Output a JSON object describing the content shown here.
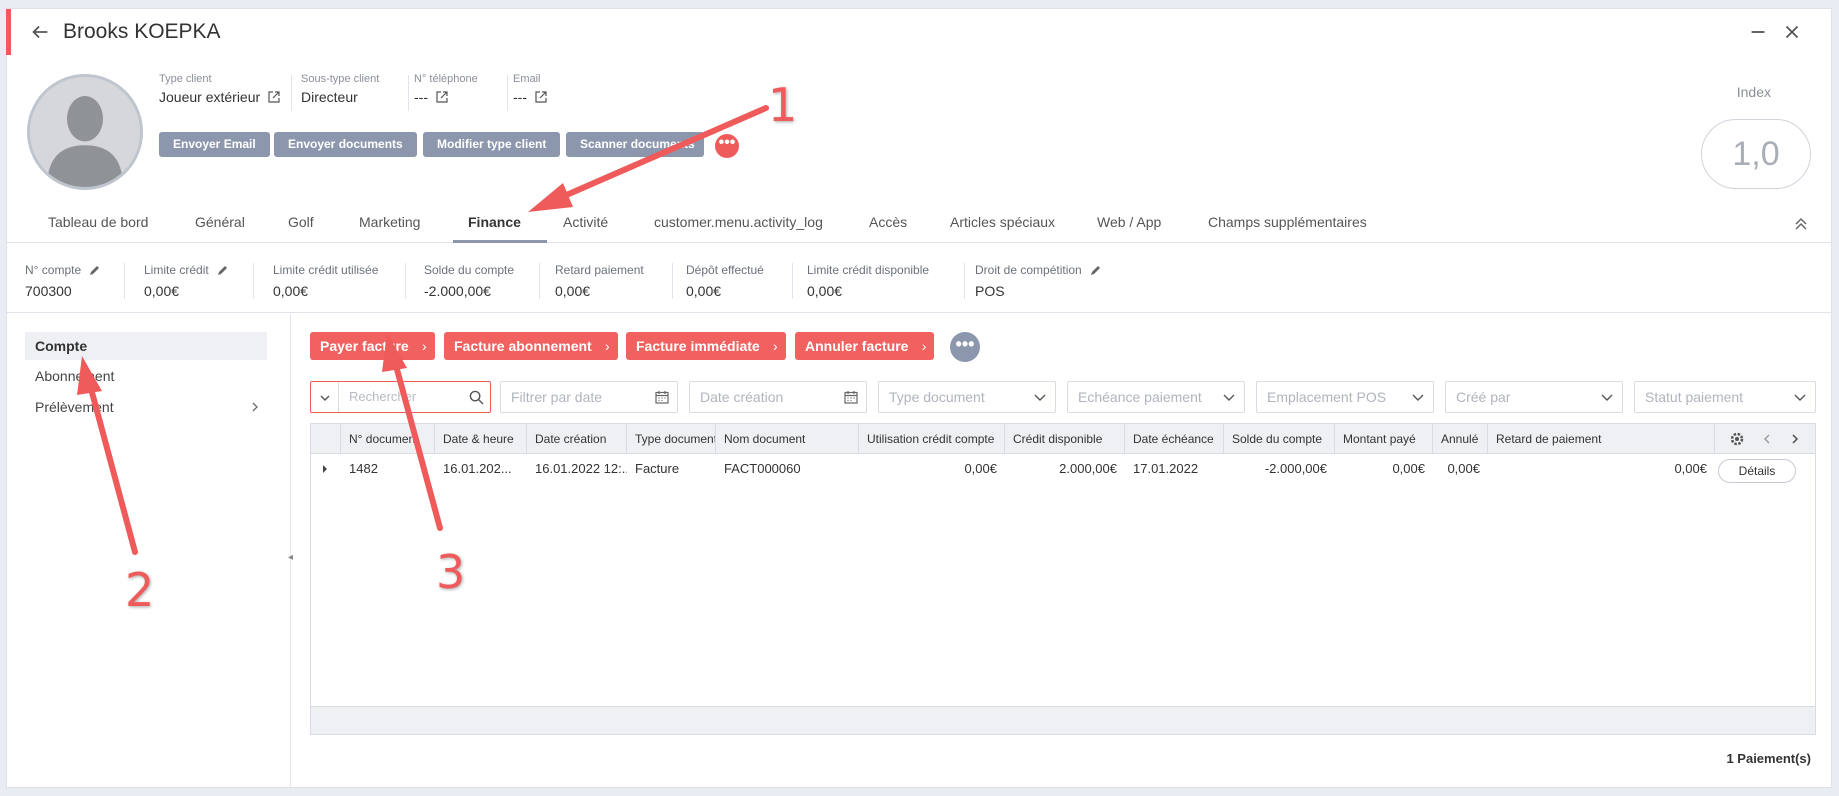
{
  "window": {
    "title": "Brooks KOEPKA",
    "back_icon": "arrow-left-icon",
    "minimize_icon": "minus-icon",
    "close_icon": "close-icon"
  },
  "profile": {
    "avatar_icon": "user-silhouette-icon",
    "type_client_label": "Type client",
    "type_client_value": "Joueur extérieur",
    "sous_type_label": "Sous-type client",
    "sous_type_value": "Directeur",
    "telephone_label": "N° téléphone",
    "telephone_value": "---",
    "email_label": "Email",
    "email_value": "---"
  },
  "actions": {
    "envoyer_email": "Envoyer Email",
    "envoyer_documents": "Envoyer documents",
    "modifier_type": "Modifier type client",
    "scanner": "Scanner documents",
    "more": "•••"
  },
  "index": {
    "label": "Index",
    "value": "1,0"
  },
  "tabs": [
    {
      "label": "Tableau de bord"
    },
    {
      "label": "Général"
    },
    {
      "label": "Golf"
    },
    {
      "label": "Marketing"
    },
    {
      "label": "Finance"
    },
    {
      "label": "Activité"
    },
    {
      "label": "customer.menu.activity_log"
    },
    {
      "label": "Accès"
    },
    {
      "label": "Articles spéciaux"
    },
    {
      "label": "Web / App"
    },
    {
      "label": "Champs supplémentaires"
    }
  ],
  "active_tab": "Finance",
  "finance": [
    {
      "label": "N° compte",
      "value": "700300"
    },
    {
      "label": "Limite crédit",
      "value": "0,00€"
    },
    {
      "label": "Limite crédit utilisée",
      "value": "0,00€"
    },
    {
      "label": "Solde du compte",
      "value": "-2.000,00€"
    },
    {
      "label": "Retard paiement",
      "value": "0,00€"
    },
    {
      "label": "Dépôt effectué",
      "value": "0,00€"
    },
    {
      "label": "Limite crédit disponible",
      "value": "0,00€"
    },
    {
      "label": "Droit de compétition",
      "value": "POS"
    }
  ],
  "sidebar": {
    "items": [
      {
        "label": "Compte"
      },
      {
        "label": "Abonnement"
      },
      {
        "label": "Prélèvement"
      }
    ]
  },
  "invoice_buttons": {
    "payer": "Payer facture",
    "abonnement": "Facture abonnement",
    "immediate": "Facture immédiate",
    "annuler": "Annuler facture",
    "chevron": "›",
    "more": "•••"
  },
  "filters": {
    "search_placeholder": "Rechercher",
    "date": "Filtrer par date",
    "date_creation": "Date création",
    "type_document": "Type document",
    "echeance": "Echéance paiement",
    "emplacement": "Emplacement POS",
    "cree_par": "Créé par",
    "statut": "Statut paiement"
  },
  "table": {
    "headers": [
      "N° document",
      "Date & heure",
      "Date création",
      "Type document",
      "Nom document",
      "Utilisation crédit compte",
      "Crédit disponible",
      "Date échéance",
      "Solde du compte",
      "Montant payé",
      "Annulé",
      "Retard de paiement"
    ],
    "rows": [
      {
        "numero": "1482",
        "date_heure": "16.01.202...",
        "date_creation": "16.01.2022 12:...",
        "type": "Facture",
        "nom": "FACT000060",
        "utilisation": "0,00€",
        "credit": "2.000,00€",
        "echeance": "17.01.2022",
        "solde": "-2.000,00€",
        "montant": "0,00€",
        "annule": "0,00€",
        "retard": "0,00€",
        "details": "Détails"
      }
    ]
  },
  "footer": {
    "count": "1 Paiement(s)"
  },
  "annotations": {
    "n1": "1",
    "n2": "2",
    "n3": "3"
  },
  "colors": {
    "accent": "#ef5a5a",
    "button_gray": "#8c97ad",
    "button_red": "#f06160"
  }
}
